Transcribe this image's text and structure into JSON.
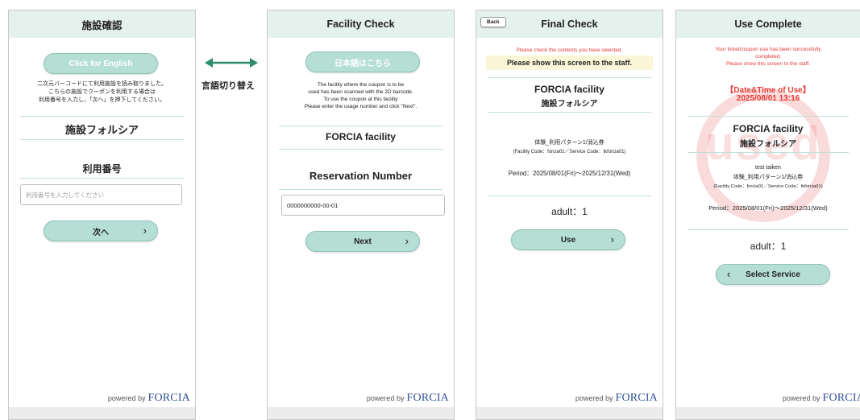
{
  "screen1": {
    "header": "施設確認",
    "lang_button": "Click for English",
    "instructions": [
      "二次元バーコードにて利用施設を読み取りました。",
      "こちらの施設でクーポンを利用する場合は",
      "利用番号を入力し、「次へ」を押下してください。"
    ],
    "facility": "施設フォルシア",
    "number_label": "利用番号",
    "input_placeholder": "利用番号を入力してください",
    "next_button": "次へ",
    "chevron": "›"
  },
  "switch_label": "言語切り替え",
  "screen2": {
    "header": "Facility Check",
    "lang_button": "日本語はこちら",
    "instructions": [
      "The facility where the coupon is to be",
      "used has been scanned with the 2D barcode.",
      "To use the coupon at this facility",
      "Please enter the usage number and click \"Next\"."
    ],
    "facility": "FORCIA facility",
    "number_label": "Reservation Number",
    "input_value": "0000000000-00-01",
    "next_button": "Next",
    "chevron": "›"
  },
  "screen3": {
    "back_button": "Back",
    "header": "Final Check",
    "notice_red": "Please check the contents you have selected.",
    "notice_bold": "Please show this screen to the staff.",
    "facility_en": "FORCIA facility",
    "facility_ja": "施設フォルシア",
    "ticket": "体験_利用パターン1/消込券",
    "codes": "(Facility Code：forcia01／Service Code：tkforcia01)",
    "period": "Period：2025/08/01(Fri)～2025/12/31(Wed)",
    "quantity": "adult：1",
    "use_button": "Use",
    "chevron": "›"
  },
  "screen4": {
    "header": "Use Complete",
    "notice": [
      "Your ticket/coupon use has been successfully",
      "completed.",
      "Please show this screen to the staff."
    ],
    "datetime_label": "【Date&Time of Use】",
    "datetime": "2025/08/01 13:16",
    "stamp_text": "used",
    "facility_en": "FORCIA facility",
    "facility_ja": "施設フォルシア",
    "user": "test taiken",
    "ticket": "体験_利用パターン1/消込券",
    "codes": "(Facility Code：forcia01／Service Code：tkforcia01)",
    "period": "Period：2025/08/01(Fri)～2025/12/31(Wed)",
    "quantity": "adult：1",
    "select_button": "Select Service",
    "chevron_left": "‹"
  },
  "footer": {
    "powered": "powered by",
    "brand": "FORCIA"
  },
  "colors": {
    "header_bg": "#e4f1ec",
    "button": "#b5ded5",
    "accent_arrow": "#2e8b6e",
    "red": "#e53935"
  }
}
